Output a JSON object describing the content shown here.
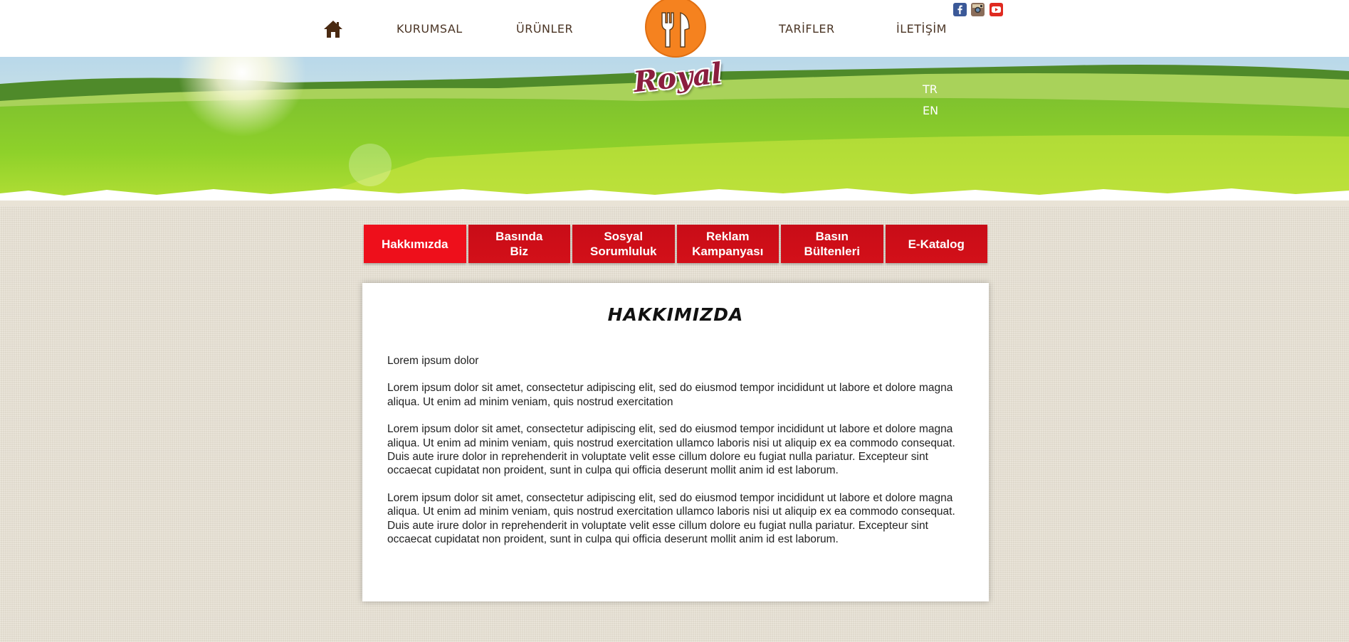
{
  "nav": {
    "items": [
      {
        "label": "KURUMSAL"
      },
      {
        "label": "ÜRÜNLER"
      },
      {
        "label": "TARİFLER"
      },
      {
        "label": "İLETİŞİM"
      }
    ],
    "home_icon": "home-icon",
    "logo_text": "Royal"
  },
  "social": [
    {
      "name": "facebook-icon",
      "color": "#3b5998"
    },
    {
      "name": "instagram-icon",
      "color": "#8a6d5a"
    },
    {
      "name": "youtube-icon",
      "color": "#e02a20"
    }
  ],
  "languages": [
    "TR",
    "EN"
  ],
  "tabs": [
    {
      "label": "Hakkımızda",
      "active": true
    },
    {
      "label": "Basında\nBiz",
      "active": false
    },
    {
      "label": "Sosyal\nSorumluluk",
      "active": false
    },
    {
      "label": "Reklam\nKampanyası",
      "active": false
    },
    {
      "label": "Basın\nBültenleri",
      "active": false
    },
    {
      "label": "E-Katalog",
      "active": false
    }
  ],
  "content": {
    "title": "HAKKIMIZDA",
    "paragraphs": [
      "Lorem ipsum dolor",
      "Lorem ipsum dolor sit amet, consectetur adipiscing elit, sed do eiusmod tempor incididunt ut labore et dolore magna aliqua. Ut enim ad minim veniam, quis nostrud exercitation",
      "Lorem ipsum dolor sit amet, consectetur adipiscing elit, sed do eiusmod tempor incididunt ut labore et dolore magna aliqua. Ut enim ad minim veniam, quis nostrud exercitation ullamco laboris nisi ut aliquip ex ea commodo consequat. Duis aute irure dolor in reprehenderit in voluptate velit esse cillum dolore eu fugiat nulla pariatur. Excepteur sint occaecat cupidatat non proident, sunt in culpa qui officia deserunt mollit anim id est laborum.",
      "Lorem ipsum dolor sit amet, consectetur adipiscing elit, sed do eiusmod tempor incididunt ut labore et dolore magna aliqua. Ut enim ad minim veniam, quis nostrud exercitation ullamco laboris nisi ut aliquip ex ea commodo consequat. Duis aute irure dolor in reprehenderit in voluptate velit esse cillum dolore eu fugiat nulla pariatur. Excepteur sint occaecat cupidatat non proident, sunt in culpa qui officia deserunt mollit anim id est laborum."
    ]
  },
  "colors": {
    "tab_red": "#d31019",
    "tab_active": "#ee0f1b",
    "nav_text": "#4a3424",
    "logo_orange": "#f5821f",
    "logo_text": "#8b1e3f"
  }
}
